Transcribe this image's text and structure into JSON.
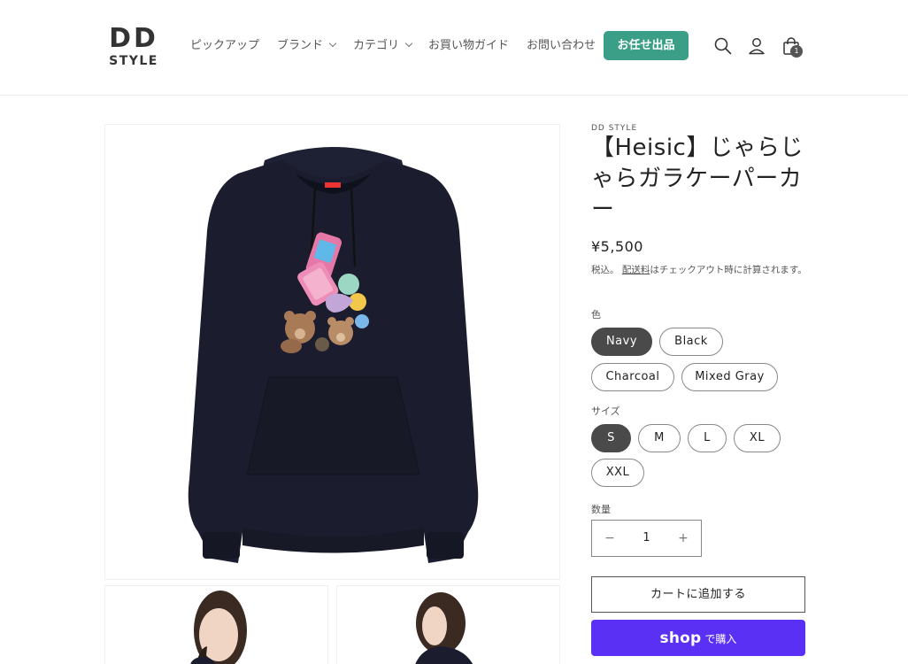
{
  "header": {
    "logo": {
      "line1": "DD",
      "line2": "STYLE"
    },
    "nav": [
      {
        "label": "ピックアップ",
        "has_dropdown": false
      },
      {
        "label": "ブランド",
        "has_dropdown": true
      },
      {
        "label": "カテゴリ",
        "has_dropdown": true
      },
      {
        "label": "お買い物ガイド",
        "has_dropdown": false
      },
      {
        "label": "お問い合わせ",
        "has_dropdown": false
      }
    ],
    "cta_label": "お任せ出品",
    "cart_count": "1",
    "icons": [
      "search-icon",
      "account-icon",
      "cart-icon"
    ],
    "accent_color": "#3b9f87"
  },
  "product": {
    "vendor": "DD STYLE",
    "title": "【Heisic】じゃらじゃらガラケーパーカー",
    "price": "¥5,500",
    "tax_prefix": "税込。",
    "tax_link": "配送料",
    "tax_suffix": "はチェックアウト時に計算されます。",
    "color_label": "色",
    "colors": [
      {
        "label": "Navy",
        "selected": true
      },
      {
        "label": "Black",
        "selected": false
      },
      {
        "label": "Charcoal",
        "selected": false
      },
      {
        "label": "Mixed Gray",
        "selected": false
      }
    ],
    "size_label": "サイズ",
    "sizes": [
      {
        "label": "S",
        "selected": true
      },
      {
        "label": "M",
        "selected": false
      },
      {
        "label": "L",
        "selected": false
      },
      {
        "label": "XL",
        "selected": false
      },
      {
        "label": "XXL",
        "selected": false
      }
    ],
    "quantity_label": "数量",
    "quantity": "1",
    "qty_minus": "−",
    "qty_plus": "+",
    "add_to_cart": "カートに追加する",
    "shop_pay_brand": "shop",
    "shop_pay_label": "で購入",
    "shop_pay_color": "#5a31f4"
  }
}
